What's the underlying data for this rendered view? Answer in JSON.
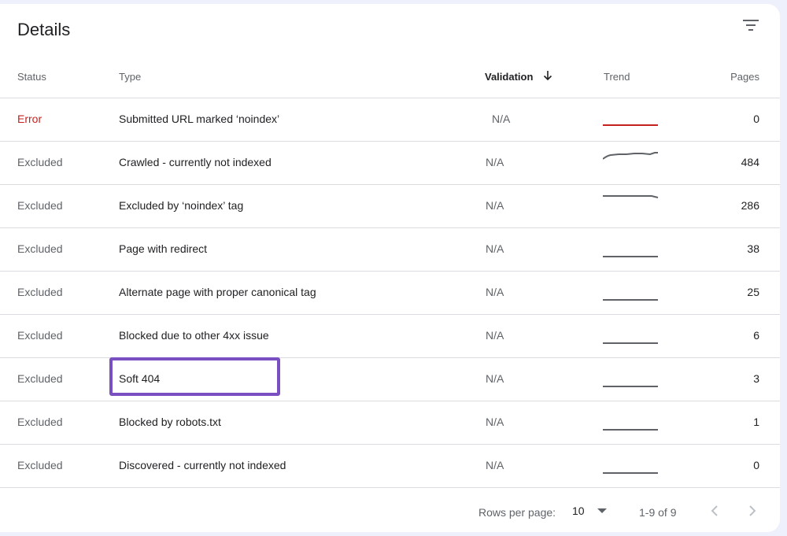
{
  "card": {
    "title": "Details"
  },
  "icons": {
    "filter": "filter-list-icon",
    "sort": "arrow-down-icon",
    "dropdown": "caret-down-icon",
    "prev": "chevron-left-icon",
    "next": "chevron-right-icon"
  },
  "columns": {
    "status": "Status",
    "type": "Type",
    "validation": "Validation",
    "trend": "Trend",
    "pages": "Pages"
  },
  "rows": [
    {
      "status": "Error",
      "type": "Submitted URL marked ‘noindex’",
      "validation": "N/A",
      "pages": "0"
    },
    {
      "status": "Excluded",
      "type": "Crawled - currently not indexed",
      "validation": "N/A",
      "pages": "484"
    },
    {
      "status": "Excluded",
      "type": "Excluded by ‘noindex’ tag",
      "validation": "N/A",
      "pages": "286"
    },
    {
      "status": "Excluded",
      "type": "Page with redirect",
      "validation": "N/A",
      "pages": "38"
    },
    {
      "status": "Excluded",
      "type": "Alternate page with proper canonical tag",
      "validation": "N/A",
      "pages": "25"
    },
    {
      "status": "Excluded",
      "type": "Blocked due to other 4xx issue",
      "validation": "N/A",
      "pages": "6"
    },
    {
      "status": "Excluded",
      "type": "Soft 404",
      "validation": "N/A",
      "pages": "3"
    },
    {
      "status": "Excluded",
      "type": "Blocked by robots.txt",
      "validation": "N/A",
      "pages": "1"
    },
    {
      "status": "Excluded",
      "type": "Discovered - currently not indexed",
      "validation": "N/A",
      "pages": "0"
    }
  ],
  "footer": {
    "rows_per_page_label": "Rows per page:",
    "rows_per_page_value": "10",
    "range": "1-9 of 9"
  },
  "colors": {
    "error": "#c5221f",
    "highlight": "#7a4fc1",
    "trend": "#5f6368"
  }
}
